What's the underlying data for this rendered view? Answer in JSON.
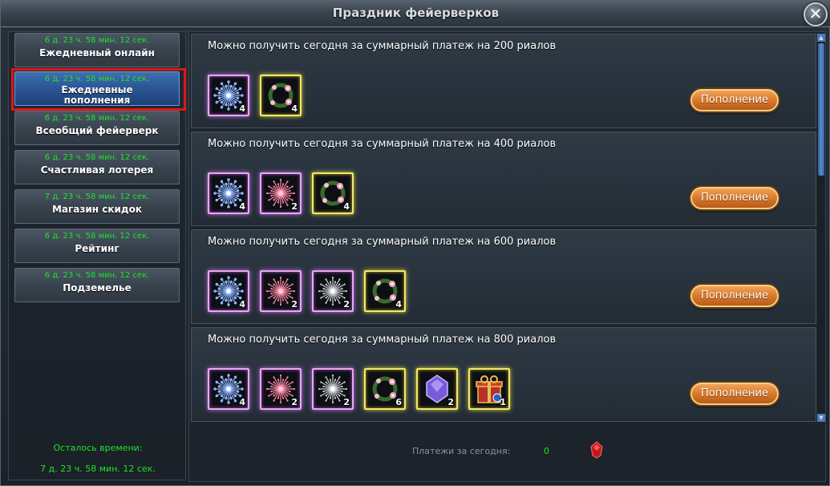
{
  "window": {
    "title": "Праздник фейерверков",
    "close_icon": "close-icon"
  },
  "sidebar": {
    "items": [
      {
        "timer": "6 д. 23 ч. 58 мин. 12 сек.",
        "label": "Ежедневный онлайн",
        "active": false
      },
      {
        "timer": "6 д. 23 ч. 58 мин. 12 сек.",
        "label": "Ежедневные пополнения",
        "active": true
      },
      {
        "timer": "6 д. 23 ч. 58 мин. 12 сек.",
        "label": "Всеобщий фейерверк",
        "active": false
      },
      {
        "timer": "6 д. 23 ч. 58 мин. 12 сек.",
        "label": "Счастливая лотерея",
        "active": false
      },
      {
        "timer": "7 д. 23 ч. 58 мин. 12 сек.",
        "label": "Магазин скидок",
        "active": false
      },
      {
        "timer": "6 д. 23 ч. 58 мин. 12 сек.",
        "label": "Рейтинг",
        "active": false
      },
      {
        "timer": "6 д. 23 ч. 58 мин. 12 сек.",
        "label": "Подземелье",
        "active": false
      }
    ],
    "remaining_label": "Осталось времени:",
    "remaining_value": "7 д. 23 ч. 58 мин. 12 сек."
  },
  "rewards": [
    {
      "caption": "Можно получить сегодня за суммарный платеж на 200 риалов",
      "button": "Пополнение",
      "items": [
        {
          "icon": "blue-firework-icon",
          "frame": "pink",
          "count": "4"
        },
        {
          "icon": "flower-wreath-icon",
          "frame": "gold",
          "count": "4"
        }
      ]
    },
    {
      "caption": "Можно получить сегодня за суммарный платеж на 400 риалов",
      "button": "Пополнение",
      "items": [
        {
          "icon": "blue-firework-icon",
          "frame": "pink",
          "count": "4"
        },
        {
          "icon": "red-firework-icon",
          "frame": "pink",
          "count": "2"
        },
        {
          "icon": "flower-wreath-icon",
          "frame": "gold",
          "count": "4"
        }
      ]
    },
    {
      "caption": "Можно получить сегодня за суммарный платеж на 600 риалов",
      "button": "Пополнение",
      "items": [
        {
          "icon": "blue-firework-icon",
          "frame": "pink",
          "count": "4"
        },
        {
          "icon": "red-firework-icon",
          "frame": "pink",
          "count": "2"
        },
        {
          "icon": "white-firework-icon",
          "frame": "pink",
          "count": "2"
        },
        {
          "icon": "flower-wreath-icon",
          "frame": "gold",
          "count": "4"
        }
      ]
    },
    {
      "caption": "Можно получить сегодня за суммарный платеж на 800 риалов",
      "button": "Пополнение",
      "items": [
        {
          "icon": "blue-firework-icon",
          "frame": "pink",
          "count": "4"
        },
        {
          "icon": "red-firework-icon",
          "frame": "pink",
          "count": "2"
        },
        {
          "icon": "white-firework-icon",
          "frame": "pink",
          "count": "2"
        },
        {
          "icon": "flower-wreath-icon",
          "frame": "gold",
          "count": "6"
        },
        {
          "icon": "purple-crystal-icon",
          "frame": "gold",
          "count": "2"
        },
        {
          "icon": "gift-box-icon",
          "frame": "gold",
          "count": "1"
        }
      ]
    }
  ],
  "footer": {
    "payments_label": "Платежи за сегодня:",
    "payments_value": "0",
    "currency_icon": "ruby-icon"
  },
  "colors": {
    "timer_green": "#22e02c",
    "active_blue": "#2a5594",
    "button_orange": "#d77a2c",
    "highlight_red": "#e01616"
  }
}
